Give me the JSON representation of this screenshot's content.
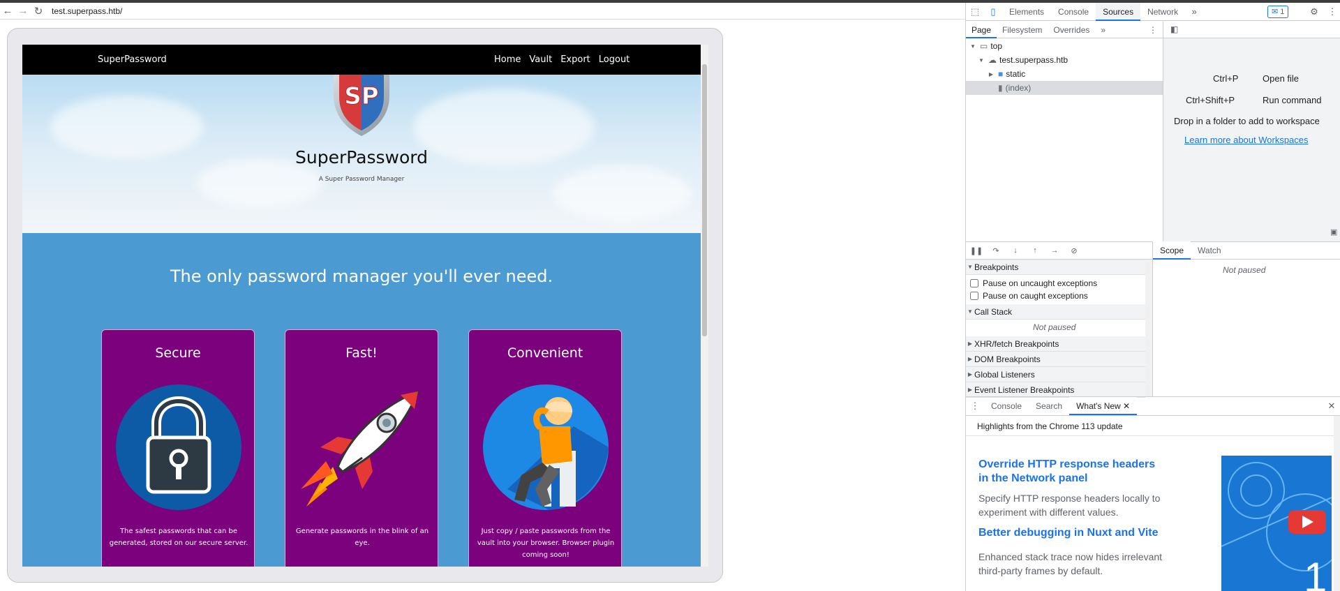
{
  "browser": {
    "url": "test.superpass.htb/"
  },
  "site": {
    "brand": "SuperPassword",
    "menu": [
      "Home",
      "Vault",
      "Export",
      "Logout"
    ],
    "hero_title": "SuperPassword",
    "hero_subtitle": "A Super Password Manager",
    "tagline": "The only password manager you'll ever need.",
    "cards": [
      {
        "title": "Secure",
        "text": "The safest passwords that can be generated, stored on our secure server.",
        "icon": "lock-icon"
      },
      {
        "title": "Fast!",
        "text": "Generate passwords in the blink of an eye.",
        "icon": "rocket-icon"
      },
      {
        "title": "Convenient",
        "text": "Just copy / paste passwords from the vault into your browser. Browser plugin coming soon!",
        "icon": "relaxing-person-icon"
      }
    ],
    "logo_letters": "SP",
    "colors": {
      "nav": "#000000",
      "body": "#4b9bd2",
      "card": "#7b017d"
    }
  },
  "devtools": {
    "tabs": [
      "Elements",
      "Console",
      "Sources",
      "Network"
    ],
    "active_tab": "Sources",
    "message_count": "1",
    "sources_tabs": [
      "Page",
      "Filesystem",
      "Overrides"
    ],
    "tree": {
      "top": "top",
      "host": "test.superpass.htb",
      "folder": "static",
      "file": "(index)"
    },
    "workspace": {
      "shortcut1_key": "Ctrl+P",
      "shortcut1_label": "Open file",
      "shortcut2_key": "Ctrl+Shift+P",
      "shortcut2_label": "Run command",
      "drop_hint": "Drop in a folder to add to workspace",
      "link": "Learn more about Workspaces"
    },
    "breakpoints": {
      "header": "Breakpoints",
      "uncaught": "Pause on uncaught exceptions",
      "caught": "Pause on caught exceptions",
      "call_stack": "Call Stack",
      "not_paused": "Not paused",
      "xhr": "XHR/fetch Breakpoints",
      "dom": "DOM Breakpoints",
      "global": "Global Listeners",
      "event": "Event Listener Breakpoints"
    },
    "scope_tabs": [
      "Scope",
      "Watch"
    ],
    "scope_status": "Not paused",
    "drawer_tabs": [
      "Console",
      "Search",
      "What's New"
    ],
    "whats_new": {
      "highlights": "Highlights from the Chrome 113 update",
      "h1": "Override HTTP response headers in the Network panel",
      "p1": "Specify HTTP response headers locally to experiment with different values.",
      "h2": "Better debugging in Nuxt and Vite",
      "p2": "Enhanced stack trace now hides irrelevant third-party frames by default.",
      "image_number": "1"
    }
  }
}
